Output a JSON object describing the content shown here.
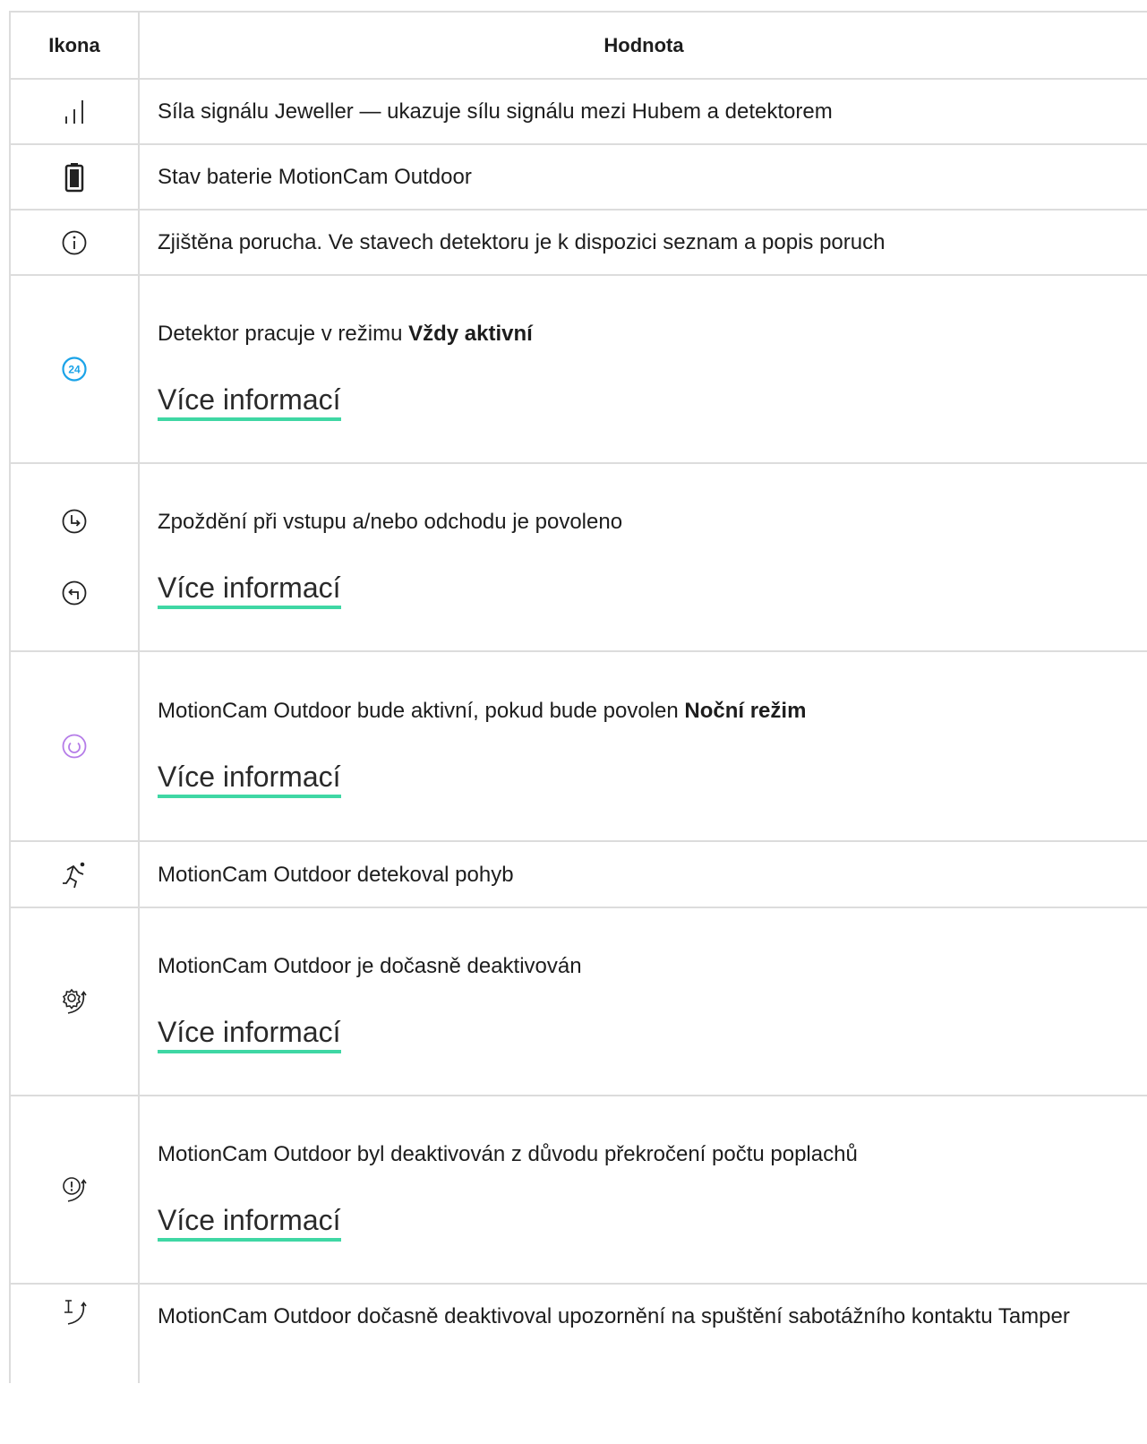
{
  "header": {
    "col_icon": "Ikona",
    "col_value": "Hodnota"
  },
  "rows": [
    {
      "icon": "signal-strength-icon",
      "text": "Síla signálu Jeweller — ukazuje sílu signálu mezi Hubem a detektorem"
    },
    {
      "icon": "battery-icon",
      "text": "Stav baterie MotionCam Outdoor"
    },
    {
      "icon": "info-icon",
      "text": "Zjištěna porucha. Ve stavech detektoru je k dispozici seznam a popis poruch"
    },
    {
      "icon": "always-active-24-icon",
      "text_before": "Detektor pracuje v režimu ",
      "text_bold": "Vždy aktivní",
      "link": "Více informací",
      "icon_color": "#1aa3e8",
      "icon_label": "24"
    },
    {
      "icon": "entry-exit-delay-icon",
      "text": "Zpoždění při vstupu a/nebo odchodu je povoleno",
      "link": "Více informací"
    },
    {
      "icon": "night-mode-icon",
      "text_before": "MotionCam Outdoor bude aktivní, pokud bude povolen ",
      "text_bold": "Noční režim",
      "link": "Více informací",
      "icon_color": "#b57ce8"
    },
    {
      "icon": "motion-detected-icon",
      "text": "MotionCam Outdoor detekoval pohyb"
    },
    {
      "icon": "temporarily-deactivated-icon",
      "text": "MotionCam Outdoor je dočasně deaktivován",
      "link": "Více informací"
    },
    {
      "icon": "alarm-limit-deactivated-icon",
      "text": "MotionCam Outdoor byl deaktivován z důvodu překročení počtu poplachů",
      "link": "Více informací"
    },
    {
      "icon": "tamper-deactivated-icon",
      "text": "MotionCam Outdoor dočasně deaktivoval upozornění na spuštění sabotážního kontaktu Tamper"
    }
  ],
  "colors": {
    "link_underline": "#3fd7a4",
    "border": "#dcdcdc"
  }
}
